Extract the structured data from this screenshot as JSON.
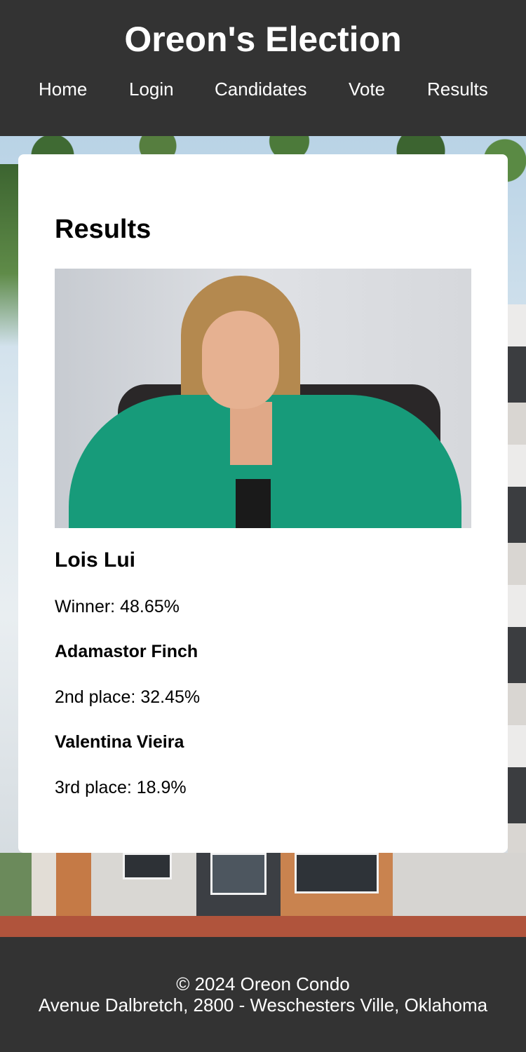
{
  "header": {
    "title": "Oreon's Election",
    "nav": [
      {
        "label": "Home"
      },
      {
        "label": "Login"
      },
      {
        "label": "Candidates"
      },
      {
        "label": "Vote"
      },
      {
        "label": "Results"
      }
    ]
  },
  "main": {
    "heading": "Results",
    "winner": {
      "name": "Lois Lui",
      "result": "Winner: 48.65%",
      "photo": "winner-photo"
    },
    "second": {
      "name": "Adamastor Finch",
      "result": "2nd place: 32.45%"
    },
    "third": {
      "name": "Valentina Vieira",
      "result": "3rd place: 18.9%"
    }
  },
  "footer": {
    "copyright": "© 2024 Oreon Condo",
    "address": "Avenue Dalbretch, 2800 - Weschesters Ville, Oklahoma"
  },
  "colors": {
    "header_bg": "#333333",
    "card_bg": "#ffffff",
    "text": "#000000",
    "header_text": "#ffffff"
  }
}
